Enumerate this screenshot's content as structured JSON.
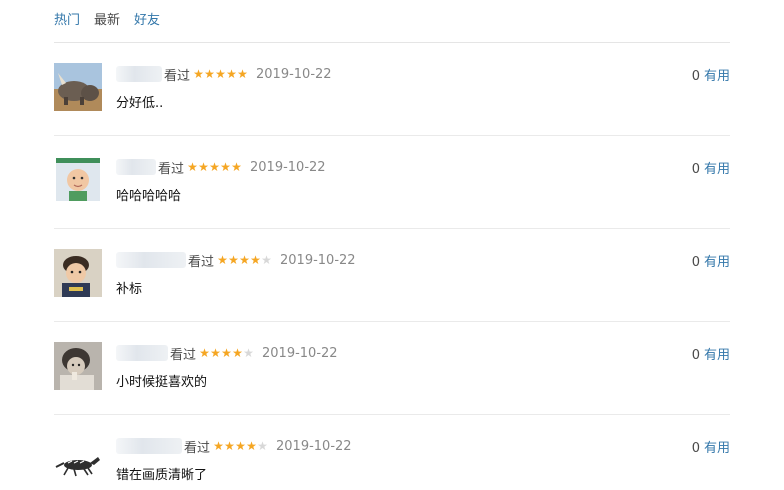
{
  "tabs": [
    {
      "label": "热门"
    },
    {
      "label": "最新"
    },
    {
      "label": "好友"
    }
  ],
  "comments": [
    {
      "status": "看过",
      "stars": 5,
      "date": "2019-10-22",
      "votes": "0",
      "vote_label": "有用",
      "text": "分好低..",
      "avatar": "rhino-icon"
    },
    {
      "status": "看过",
      "stars": 5,
      "date": "2019-10-22",
      "votes": "0",
      "vote_label": "有用",
      "text": "哈哈哈哈哈",
      "avatar": "baby-icon"
    },
    {
      "status": "看过",
      "stars": 4,
      "date": "2019-10-22",
      "votes": "0",
      "vote_label": "有用",
      "text": "补标",
      "avatar": "child-icon"
    },
    {
      "status": "看过",
      "stars": 4,
      "date": "2019-10-22",
      "votes": "0",
      "vote_label": "有用",
      "text": "小时候挺喜欢的",
      "avatar": "portrait-icon"
    },
    {
      "status": "看过",
      "stars": 4,
      "date": "2019-10-22",
      "votes": "0",
      "vote_label": "有用",
      "text": "错在画质清晰了",
      "avatar": "horse-icon"
    }
  ]
}
